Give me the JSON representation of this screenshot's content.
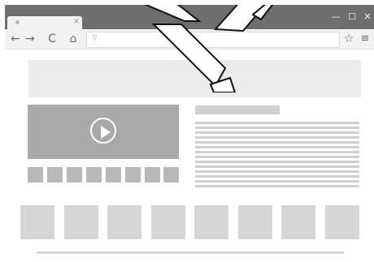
{
  "window": {
    "controls": {
      "minimize": "—",
      "maximize": "☐",
      "close": "✕"
    }
  },
  "tab": {
    "close": "×"
  },
  "toolbar": {
    "back": "←",
    "forward": "→",
    "reload": "C",
    "home": "⌂",
    "search_glyph": "⚲",
    "bookmark": "☆",
    "menu": "≡"
  },
  "colors": {
    "titlebar": "#6e6e6e",
    "toolbar": "#f2f2f2",
    "placeholder_dark": "#a9a9a9",
    "placeholder_mid": "#b8b8b8",
    "placeholder_light": "#d6d6d6"
  },
  "icons": {
    "play": "play-icon",
    "watermark": "watermark-logo"
  }
}
